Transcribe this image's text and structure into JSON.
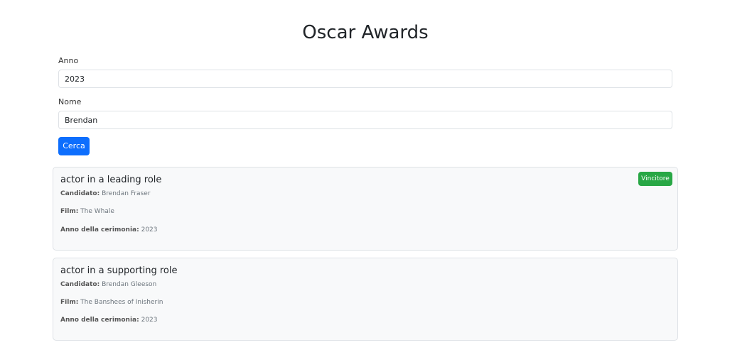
{
  "page": {
    "title": "Oscar Awards"
  },
  "form": {
    "year_label": "Anno",
    "year_value": "2023",
    "name_label": "Nome",
    "name_value": "Brendan",
    "search_button": "Cerca"
  },
  "labels": {
    "nominee": "Candidato:",
    "film": "Film:",
    "ceremony_year": "Anno della cerimonia:"
  },
  "results": [
    {
      "category": "actor in a leading role",
      "nominee": "Brendan Fraser",
      "film": "The Whale",
      "ceremony_year": "2023",
      "badge": "Vincitore",
      "winner": true
    },
    {
      "category": "actor in a supporting role",
      "nominee": "Brendan Gleeson",
      "film": "The Banshees of Inisherin",
      "ceremony_year": "2023",
      "winner": false
    }
  ],
  "colors": {
    "primary": "#0d6efd",
    "success": "#28a745",
    "card_bg": "#f8f9fa"
  }
}
